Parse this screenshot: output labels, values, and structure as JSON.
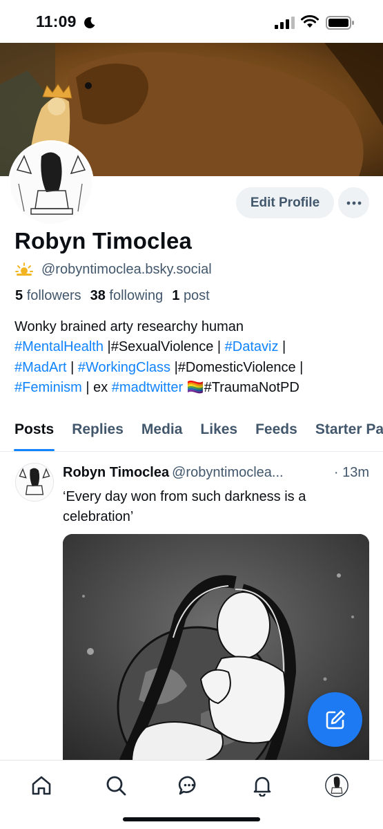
{
  "status_bar": {
    "time": "11:09"
  },
  "profile": {
    "display_name": "Robyn Timoclea",
    "handle_emoji": "🌥",
    "handle": "@robyntimoclea.bsky.social",
    "followers_count": "5",
    "followers_label": "followers",
    "following_count": "38",
    "following_label": "following",
    "posts_count": "1",
    "posts_label": "post",
    "edit_profile_label": "Edit Profile",
    "bio": {
      "line1": "Wonky brained arty researchy human",
      "tag_mentalhealth": "#MentalHealth",
      "sep1": " |#SexualViolence | ",
      "tag_dataviz": "#Dataviz",
      "sep2": " |",
      "tag_madart": "#MadArt",
      "sep3": " | ",
      "tag_workingclass": "#WorkingClass",
      "sep4": " |#DomesticViolence |",
      "tag_feminism": "#Feminism",
      "sep5": " | ex ",
      "tag_madtwitter": "#madtwitter",
      "sep6": " 🏳️‍🌈#TraumaNotPD"
    }
  },
  "tabs": [
    "Posts",
    "Replies",
    "Media",
    "Likes",
    "Feeds",
    "Starter Packs"
  ],
  "post": {
    "author": "Robyn Timoclea",
    "handle": "@robyntimoclea...",
    "time": "· 13m",
    "text": "‘Every day won from such darkness is a celebration’"
  },
  "icons": {
    "moon": "moon-icon",
    "signal": "signal-icon",
    "wifi": "wifi-icon",
    "battery": "battery-icon",
    "compose": "compose-icon",
    "home": "home-icon",
    "search": "search-icon",
    "chat": "chat-icon",
    "notifications": "bell-icon",
    "profile": "avatar"
  },
  "colors": {
    "accent": "#1083fe",
    "compose": "#1d7af2",
    "muted": "#42576c"
  }
}
